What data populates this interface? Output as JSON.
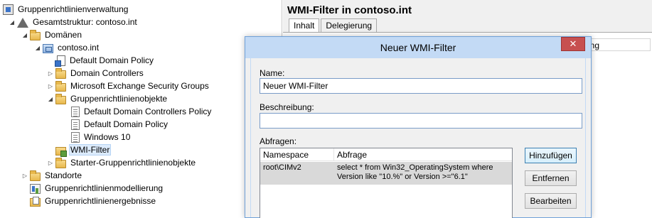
{
  "tree": {
    "items": [
      {
        "label": "Gruppenrichtlinienverwaltung",
        "icon": "gpm-icon"
      },
      {
        "label": "Gesamtstruktur: contoso.int",
        "icon": "forest-icon"
      },
      {
        "label": "Domänen",
        "icon": "domains-folder-icon"
      },
      {
        "label": "contoso.int",
        "icon": "domain-icon"
      },
      {
        "label": "Default Domain Policy",
        "icon": "gpo-link-icon"
      },
      {
        "label": "Domain Controllers",
        "icon": "ou-folder-icon"
      },
      {
        "label": "Microsoft Exchange Security Groups",
        "icon": "ou-folder-icon"
      },
      {
        "label": "Gruppenrichtlinienobjekte",
        "icon": "folder-icon"
      },
      {
        "label": "Default Domain Controllers Policy",
        "icon": "gpo-doc-icon"
      },
      {
        "label": "Default Domain Policy",
        "icon": "gpo-doc-icon"
      },
      {
        "label": "Windows 10",
        "icon": "gpo-doc-icon"
      },
      {
        "label": "WMI-Filter",
        "icon": "wmi-filter-folder-icon",
        "selected": true
      },
      {
        "label": "Starter-Gruppenrichtlinienobjekte",
        "icon": "folder-icon"
      },
      {
        "label": "Standorte",
        "icon": "sites-folder-icon"
      },
      {
        "label": "Gruppenrichtlinienmodellierung",
        "icon": "modeling-icon"
      },
      {
        "label": "Gruppenrichtlinienergebnisse",
        "icon": "results-icon"
      }
    ]
  },
  "right_pane": {
    "title": "WMI-Filter in contoso.int",
    "tabs": [
      "Inhalt",
      "Delegierung"
    ],
    "active_tab": "Inhalt",
    "column_header_partial": "ung"
  },
  "dialog": {
    "title": "Neuer WMI-Filter",
    "close_glyph": "✕",
    "name_label": "Name:",
    "name_value": "Neuer WMI-Filter",
    "description_label": "Beschreibung:",
    "description_value": "",
    "queries_label": "Abfragen:",
    "columns": [
      "Namespace",
      "Abfrage"
    ],
    "query_rows": [
      {
        "namespace": "root\\CIMv2",
        "query_line1": "select * from Win32_OperatingSystem where",
        "query_line2": "Version like \"10.%\" or Version >=\"6.1\""
      }
    ],
    "buttons": {
      "add": "Hinzufügen",
      "remove": "Entfernen",
      "edit": "Bearbeiten"
    }
  },
  "colors": {
    "dialog_titlebar": "#c3daf5",
    "close_button": "#c75050",
    "selection": "#dcebfc",
    "selected_row": "#d9d9d9"
  }
}
